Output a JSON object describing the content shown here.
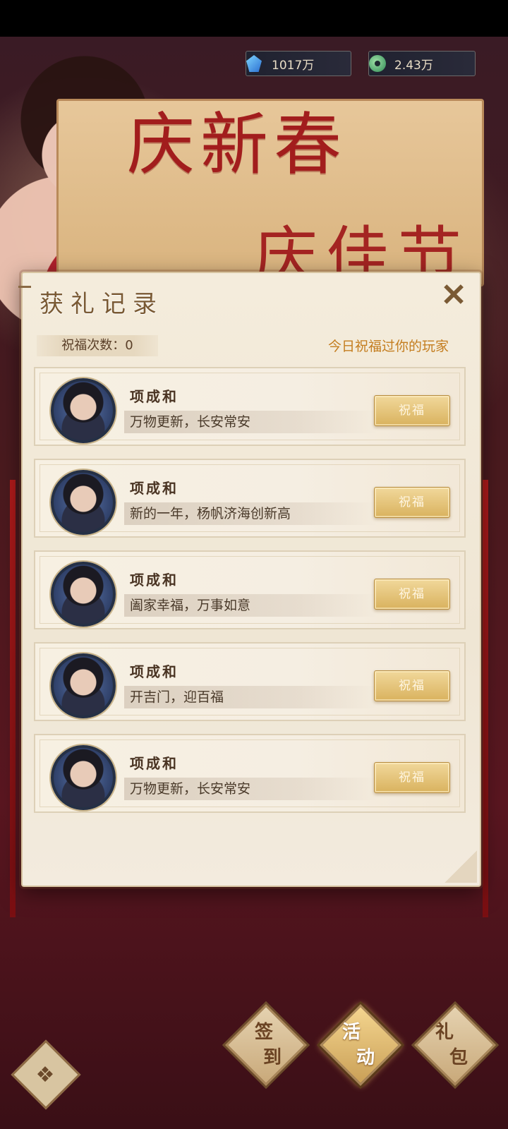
{
  "currency": {
    "crystal": {
      "icon": "crystal-icon",
      "value": "1017万"
    },
    "jade": {
      "icon": "jade-coin-icon",
      "value": "2.43万"
    }
  },
  "banner": {
    "line1": "庆新春",
    "line2": "庆佳节"
  },
  "dialog": {
    "title": "获礼记录",
    "close_label": "✕",
    "count_label": "祝福次数：0",
    "today_label": "今日祝福过你的玩家",
    "rows": [
      {
        "name": "项成和",
        "message": "万物更新，长安常安",
        "button": "祝福"
      },
      {
        "name": "项成和",
        "message": "新的一年，杨帆济海创新高",
        "button": "祝福"
      },
      {
        "name": "项成和",
        "message": "阖家幸福，万事如意",
        "button": "祝福"
      },
      {
        "name": "项成和",
        "message": "开吉门，迎百福",
        "button": "祝福"
      },
      {
        "name": "项成和",
        "message": "万物更新，长安常安",
        "button": "祝福"
      }
    ]
  },
  "nav": {
    "menu_icon": "menu-icon",
    "items": [
      {
        "label_top": "签",
        "label_bottom": "到"
      },
      {
        "label_top": "活",
        "label_bottom": "动"
      },
      {
        "label_top": "礼",
        "label_bottom": "包"
      }
    ]
  },
  "colors": {
    "accent": "#c47d1f",
    "banner_red": "#a21d1d",
    "panel": "#f4ecdc"
  }
}
